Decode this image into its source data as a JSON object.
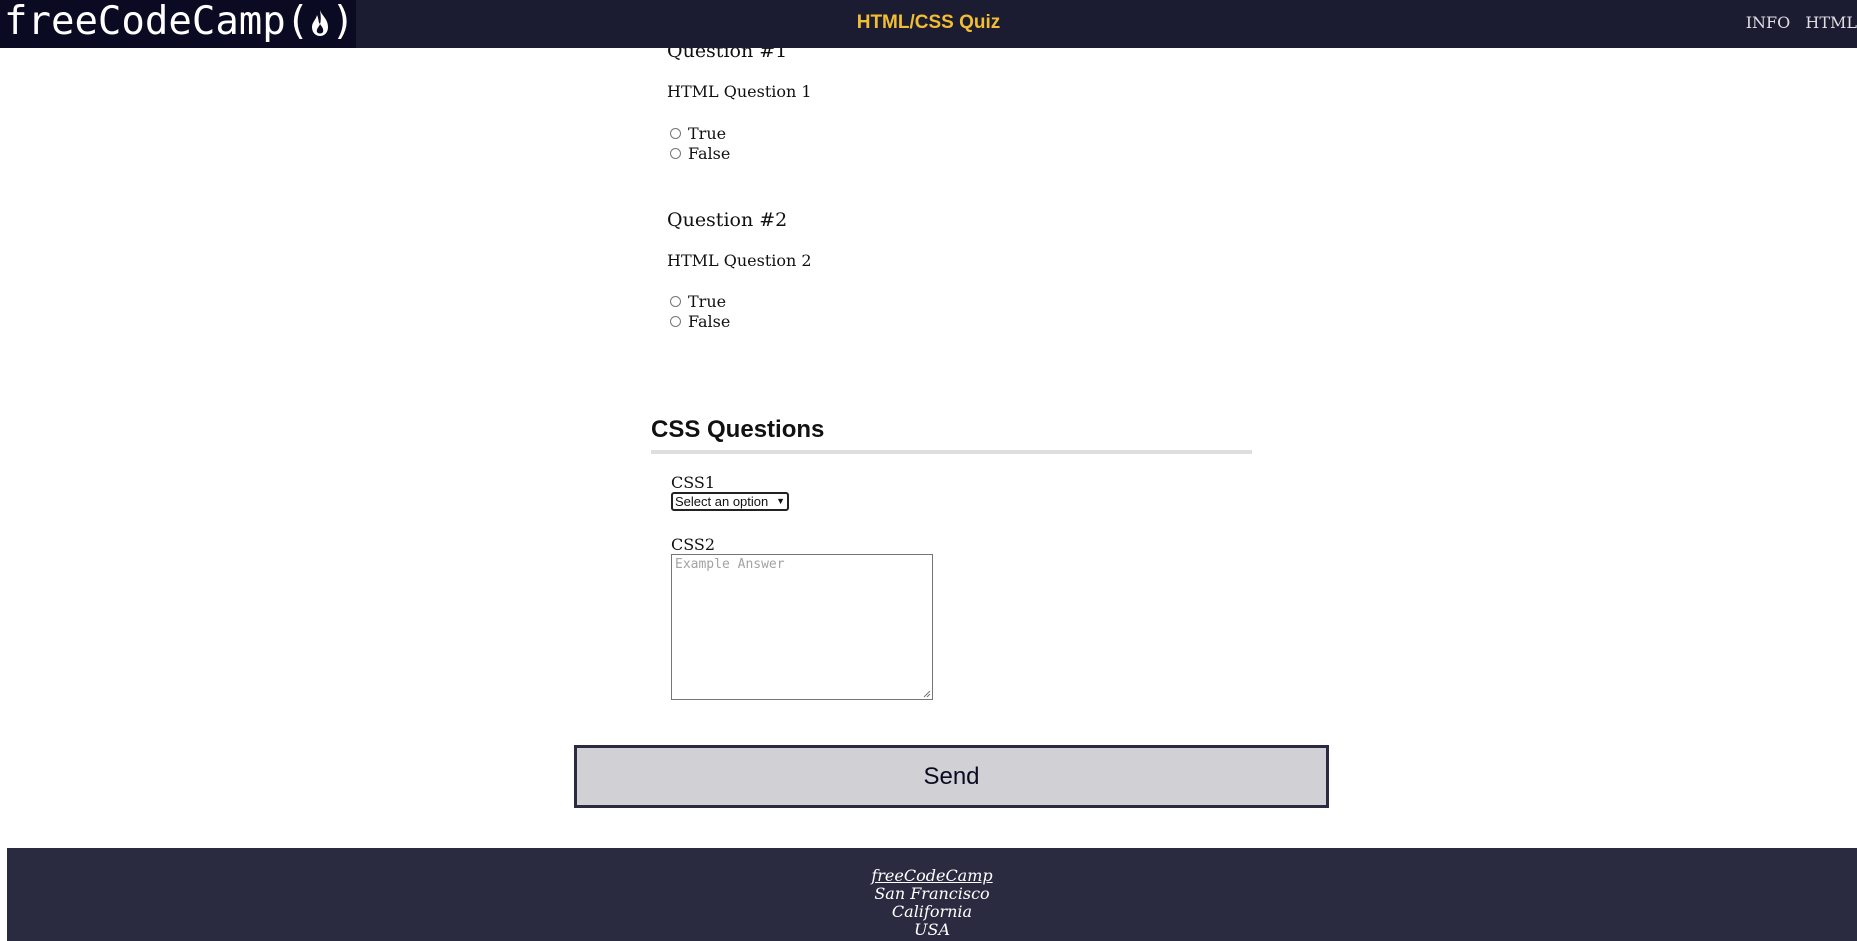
{
  "header": {
    "logo_text": "freeCodeCamp(",
    "logo_close": ")",
    "title": "HTML/CSS Quiz",
    "nav": [
      "INFO",
      "HTML"
    ]
  },
  "html_questions": [
    {
      "title": "Question #1",
      "text": "HTML Question 1",
      "options": [
        "True",
        "False"
      ]
    },
    {
      "title": "Question #2",
      "text": "HTML Question 2",
      "options": [
        "True",
        "False"
      ]
    }
  ],
  "css_section": {
    "heading": "CSS Questions",
    "css1_label": "CSS1",
    "css1_select_value": "Select an option",
    "css2_label": "CSS2",
    "css2_placeholder": "Example Answer"
  },
  "send_label": "Send",
  "footer": {
    "link": "freeCodeCamp",
    "city": "San Francisco",
    "state": "California",
    "country": "USA"
  },
  "icons": {
    "logo": "flame-icon",
    "select": "chevron-down-icon"
  },
  "colors": {
    "header_bg": "#1b1b32",
    "title": "#f1be32",
    "footer_bg": "#2a2a40",
    "button_bg": "#d0d0d5"
  }
}
